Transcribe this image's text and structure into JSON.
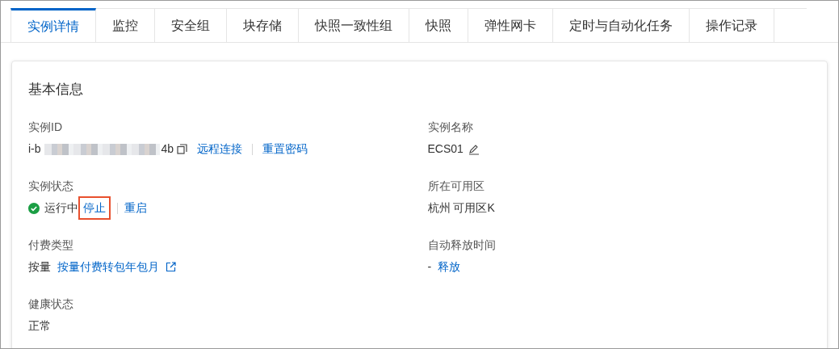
{
  "tabs": [
    {
      "label": "实例详情",
      "selected": true
    },
    {
      "label": "监控",
      "selected": false
    },
    {
      "label": "安全组",
      "selected": false
    },
    {
      "label": "块存储",
      "selected": false
    },
    {
      "label": "快照一致性组",
      "selected": false
    },
    {
      "label": "快照",
      "selected": false
    },
    {
      "label": "弹性网卡",
      "selected": false
    },
    {
      "label": "定时与自动化任务",
      "selected": false
    },
    {
      "label": "操作记录",
      "selected": false
    }
  ],
  "section": {
    "title": "基本信息",
    "columns": [
      [
        {
          "label": "实例ID",
          "value": [
            {
              "kind": "text",
              "text": "i-b"
            },
            {
              "kind": "redacted"
            },
            {
              "kind": "text",
              "text": "4b"
            },
            {
              "kind": "copy"
            },
            {
              "kind": "link",
              "text": "远程连接"
            },
            {
              "kind": "separator"
            },
            {
              "kind": "link",
              "text": "重置密码"
            }
          ]
        },
        {
          "label": "实例状态",
          "value": [
            {
              "kind": "status",
              "text": "运行中",
              "color": "#1b9e44"
            },
            {
              "kind": "link",
              "text": "停止",
              "highlighted": true
            },
            {
              "kind": "separator"
            },
            {
              "kind": "link",
              "text": "重启",
              "highlighted": false
            }
          ]
        },
        {
          "label": "付费类型",
          "value": [
            {
              "kind": "text",
              "text": "按量"
            },
            {
              "kind": "link",
              "text": "按量付费转包年包月"
            },
            {
              "kind": "external"
            }
          ]
        },
        {
          "label": "健康状态",
          "value": [
            {
              "kind": "text",
              "text": "正常"
            }
          ]
        }
      ],
      [
        {
          "label": "实例名称",
          "value": [
            {
              "kind": "text",
              "text": "ECS01"
            },
            {
              "kind": "edit"
            }
          ]
        },
        {
          "label": "所在可用区",
          "value": [
            {
              "kind": "text",
              "text": "杭州 可用区K"
            }
          ]
        },
        {
          "label": "自动释放时间",
          "value": [
            {
              "kind": "text",
              "text": "-"
            },
            {
              "kind": "link",
              "text": "释放"
            }
          ]
        }
      ]
    ]
  }
}
